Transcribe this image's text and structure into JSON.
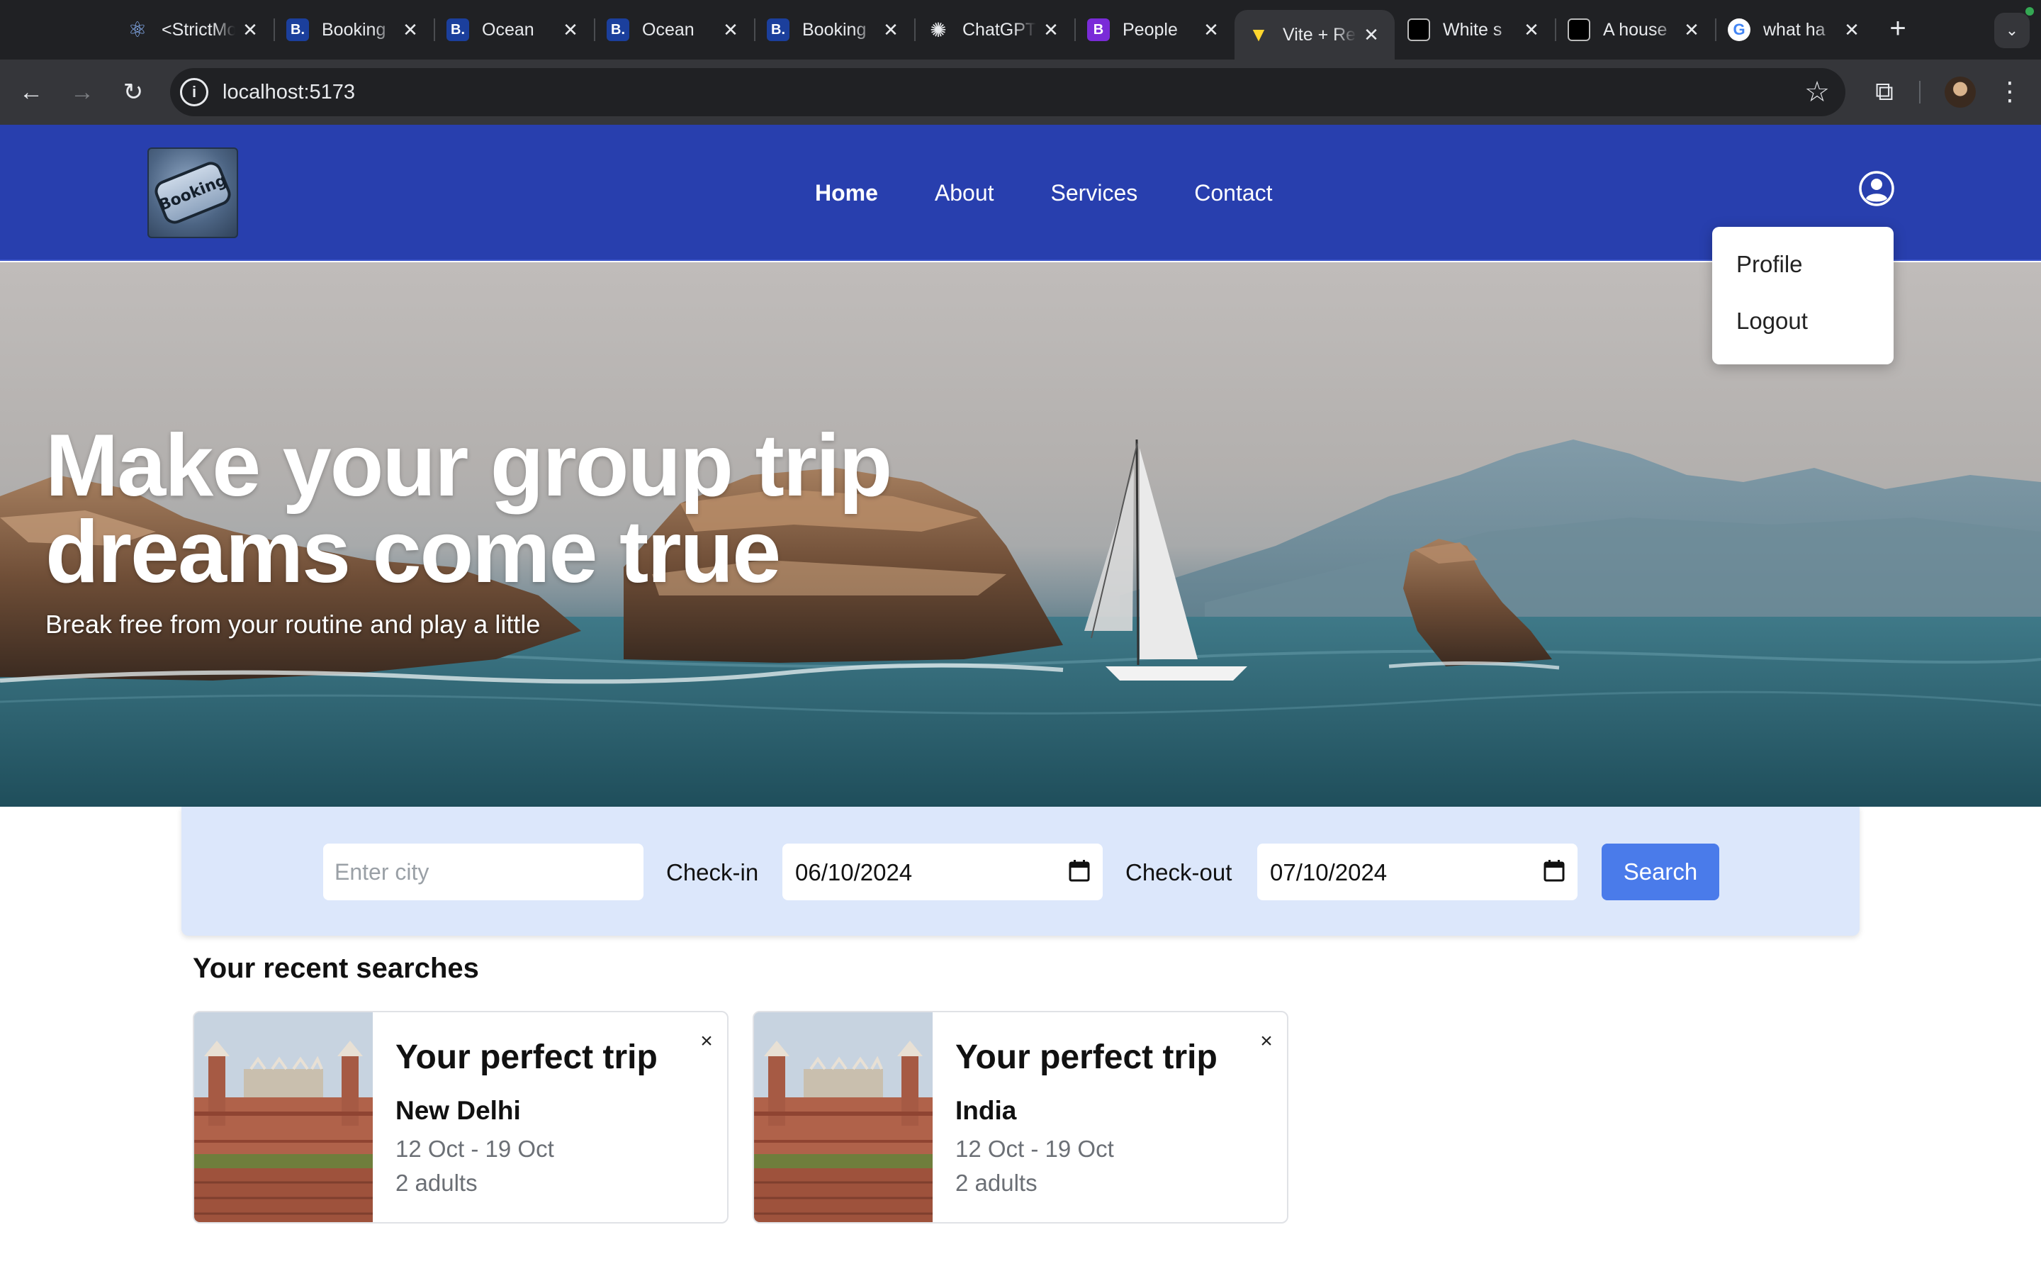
{
  "browser": {
    "tabs": [
      {
        "title": "<StrictMode>",
        "favicon": "react-icon"
      },
      {
        "title": "Booking",
        "favicon": "booking-icon"
      },
      {
        "title": "Ocean",
        "favicon": "booking-icon"
      },
      {
        "title": "Ocean",
        "favicon": "booking-icon"
      },
      {
        "title": "Booking",
        "favicon": "booking-icon"
      },
      {
        "title": "ChatGPT",
        "favicon": "openai-icon"
      },
      {
        "title": "People",
        "favicon": "bootstrap-icon"
      },
      {
        "title": "Vite + React",
        "favicon": "vite-icon",
        "active": true
      },
      {
        "title": "White s",
        "favicon": "unsplash-icon"
      },
      {
        "title": "A house",
        "favicon": "unsplash-icon"
      },
      {
        "title": "what ha",
        "favicon": "google-icon"
      }
    ],
    "url": "localhost:5173"
  },
  "navbar": {
    "logo_text": "Booking",
    "links": [
      "Home",
      "About",
      "Services",
      "Contact"
    ],
    "active_link": "Home"
  },
  "user_menu": {
    "items": [
      "Profile",
      "Logout"
    ]
  },
  "hero": {
    "title": "Make your group trip dreams come true",
    "subtitle": "Break free from your routine and play a little"
  },
  "search": {
    "city_placeholder": "Enter city",
    "checkin_label": "Check-in",
    "checkin_value": "06/10/2024",
    "checkout_label": "Check-out",
    "checkout_value": "07/10/2024",
    "button_label": "Search"
  },
  "recent": {
    "heading": "Your recent searches",
    "cards": [
      {
        "title": "Your perfect trip",
        "destination": "New Delhi",
        "dates": "12 Oct - 19 Oct",
        "guests": "2 adults"
      },
      {
        "title": "Your perfect trip",
        "destination": "India",
        "dates": "12 Oct - 19 Oct",
        "guests": "2 adults"
      }
    ]
  },
  "colors": {
    "navbar_bg": "#283fae",
    "search_panel_bg": "#dce7fb",
    "search_button_bg": "#4a7bea"
  }
}
